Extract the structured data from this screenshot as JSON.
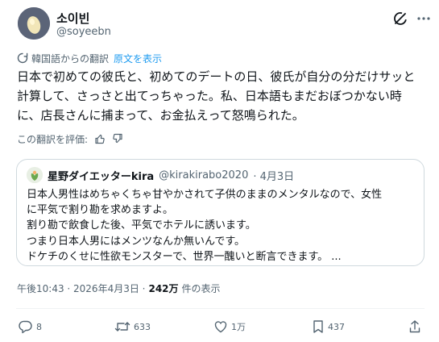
{
  "author": {
    "name": "소이빈",
    "handle": "@soyeebn"
  },
  "translation": {
    "notice": "韓国語からの翻訳",
    "show_original": "原文を表示"
  },
  "tweet_text": "日本で初めての彼氏と、初めてのデートの日、彼氏が自分の分だけサッと\n計算して、さっさと出てっちゃった。私、日本語もまだおぼつかない時\nに、店長さんに捕まって、お金払えって怒鳴られた。",
  "rate_translation": "この翻訳を評価:",
  "quoted": {
    "name": "星野ダイエッターkira",
    "handle": "@kirakirabo2020",
    "date": "· 4月3日",
    "text": "日本人男性はめちゃくちゃ甘やかされて子供のままのメンタルなので、女性\nに平気で割り勘を求めますよ。\n割り勘で飲食した後、平気でホテルに誘います。\nつまり日本人男にはメンツなんか無いんです。\nドケチのくせに性欲モンスターで、世界一醜いと断言できます。 ..."
  },
  "meta": {
    "timestamp": "午後10:43 · 2026年4月3日 ·",
    "views": "242万",
    "views_label": "件の表示"
  },
  "actions": {
    "replies": "8",
    "reposts": "633",
    "likes": "1万",
    "bookmarks": "437"
  },
  "colors": {
    "accent": "#1d9bf0",
    "text": "#0f1419",
    "secondary": "#536471",
    "border": "#cfd9de"
  }
}
